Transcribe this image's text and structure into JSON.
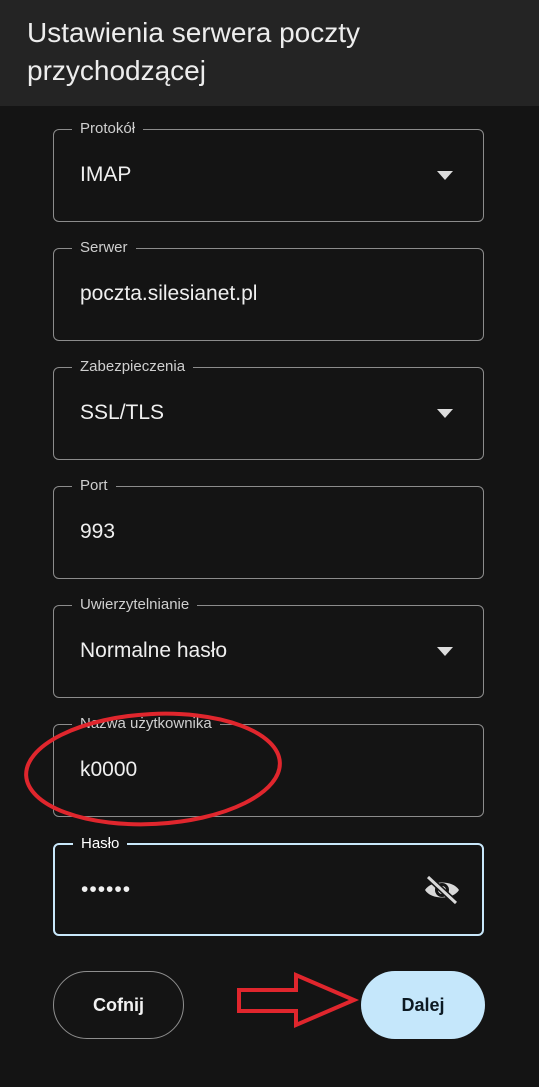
{
  "header": {
    "title": "Ustawienia serwera poczty przychodzącej"
  },
  "form": {
    "protocol": {
      "label": "Protokół",
      "value": "IMAP"
    },
    "server": {
      "label": "Serwer",
      "value": "poczta.silesianet.pl"
    },
    "security": {
      "label": "Zabezpieczenia",
      "value": "SSL/TLS"
    },
    "port": {
      "label": "Port",
      "value": "993"
    },
    "auth": {
      "label": "Uwierzytelnianie",
      "value": "Normalne hasło"
    },
    "username": {
      "label": "Nazwa użytkownika",
      "value": "k0000"
    },
    "password": {
      "label": "Hasło",
      "value": "••••••",
      "toggle_icon": "eye-off-icon"
    }
  },
  "actions": {
    "back_label": "Cofnij",
    "next_label": "Dalej"
  },
  "colors": {
    "background": "#141414",
    "appbar": "#242424",
    "accent": "#c5e7fb",
    "annotation": "#e0262d"
  }
}
